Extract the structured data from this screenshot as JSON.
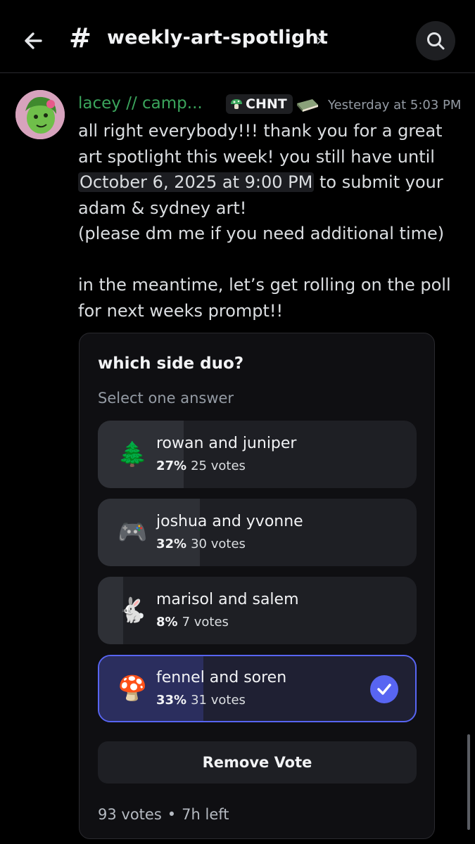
{
  "header": {
    "back_icon": "back-arrow-icon",
    "hash": "#",
    "channel_name": "weekly-art-spotlight",
    "chevron": "›",
    "search_icon": "search-icon"
  },
  "message": {
    "author": "lacey // camp...",
    "tag": "CHNT",
    "tag_icon": "mushroom-icon",
    "badge_icon": "book-icon",
    "timestamp": "Yesterday at 5:03 PM",
    "line1": "all right everybody!!! thank you for a great art spotlight this week! you still have until",
    "date_chip": "October 6, 2025 at 9:00 PM",
    "line1_tail": " to submit your adam & sydney art!",
    "line2": "(please dm me if you need additional time)",
    "line3": "in the meantime, let’s get rolling on the poll for next weeks prompt!!"
  },
  "poll": {
    "question": "which side duo?",
    "subtitle": "Select one answer",
    "options": [
      {
        "emoji": "🌲",
        "label": "rowan and juniper",
        "percent": "27%",
        "votes": "25 votes",
        "fraction": 0.27,
        "selected": false
      },
      {
        "emoji": "🎮",
        "label": "joshua and yvonne",
        "percent": "32%",
        "votes": "30 votes",
        "fraction": 0.32,
        "selected": false
      },
      {
        "emoji": "🐇",
        "label": "marisol and salem",
        "percent": "8%",
        "votes": "7 votes",
        "fraction": 0.08,
        "selected": false
      },
      {
        "emoji": "🍄",
        "label": "fennel and soren",
        "percent": "33%",
        "votes": "31 votes",
        "fraction": 0.33,
        "selected": true
      }
    ],
    "remove_vote": "Remove Vote",
    "total_votes": "93 votes",
    "separator": "•",
    "time_left": "7h left"
  },
  "colors": {
    "accent": "#5865f2",
    "author": "#3ba55c"
  }
}
